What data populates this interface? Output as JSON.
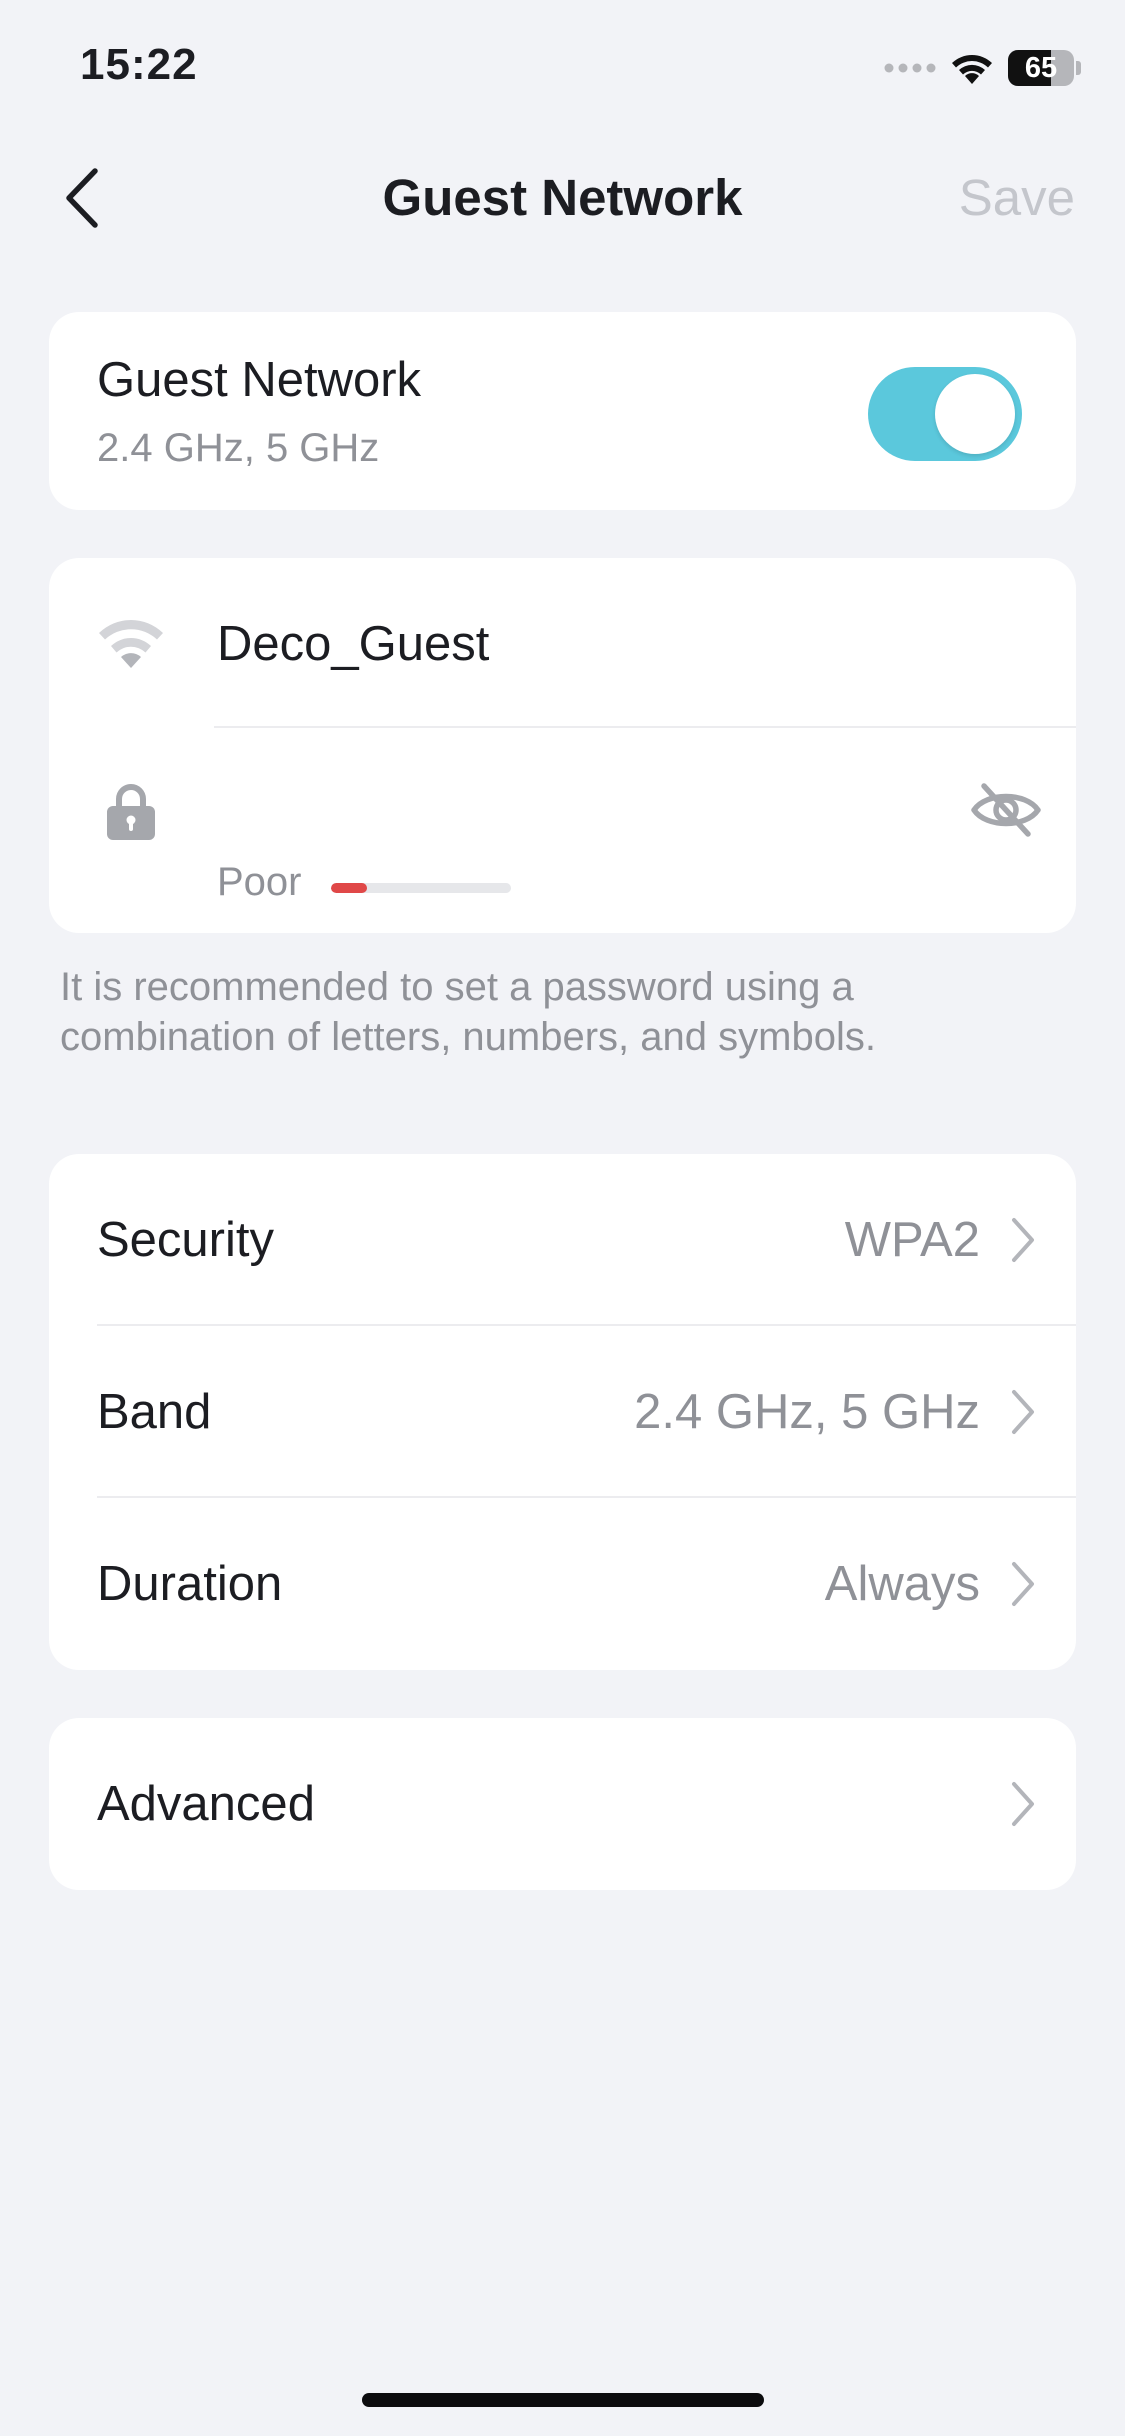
{
  "status_bar": {
    "time": "15:22",
    "battery_level": "65",
    "battery_fraction": 0.65
  },
  "nav": {
    "title": "Guest Network",
    "save_label": "Save"
  },
  "guest_toggle": {
    "title": "Guest Network",
    "subtitle": "2.4 GHz, 5 GHz",
    "enabled": true
  },
  "credentials": {
    "ssid": "Deco_Guest",
    "password_value": "",
    "strength_label": "Poor",
    "strength_fraction": 0.2
  },
  "hint": "It is recommended to set a password using a combination of letters, numbers, and symbols.",
  "settings": [
    {
      "label": "Security",
      "value": "WPA2"
    },
    {
      "label": "Band",
      "value": "2.4 GHz, 5 GHz"
    },
    {
      "label": "Duration",
      "value": "Always"
    }
  ],
  "advanced": {
    "label": "Advanced"
  },
  "colors": {
    "accent": "#5bc8dc",
    "strength_poor": "#e04848",
    "background": "#f2f3f7"
  }
}
